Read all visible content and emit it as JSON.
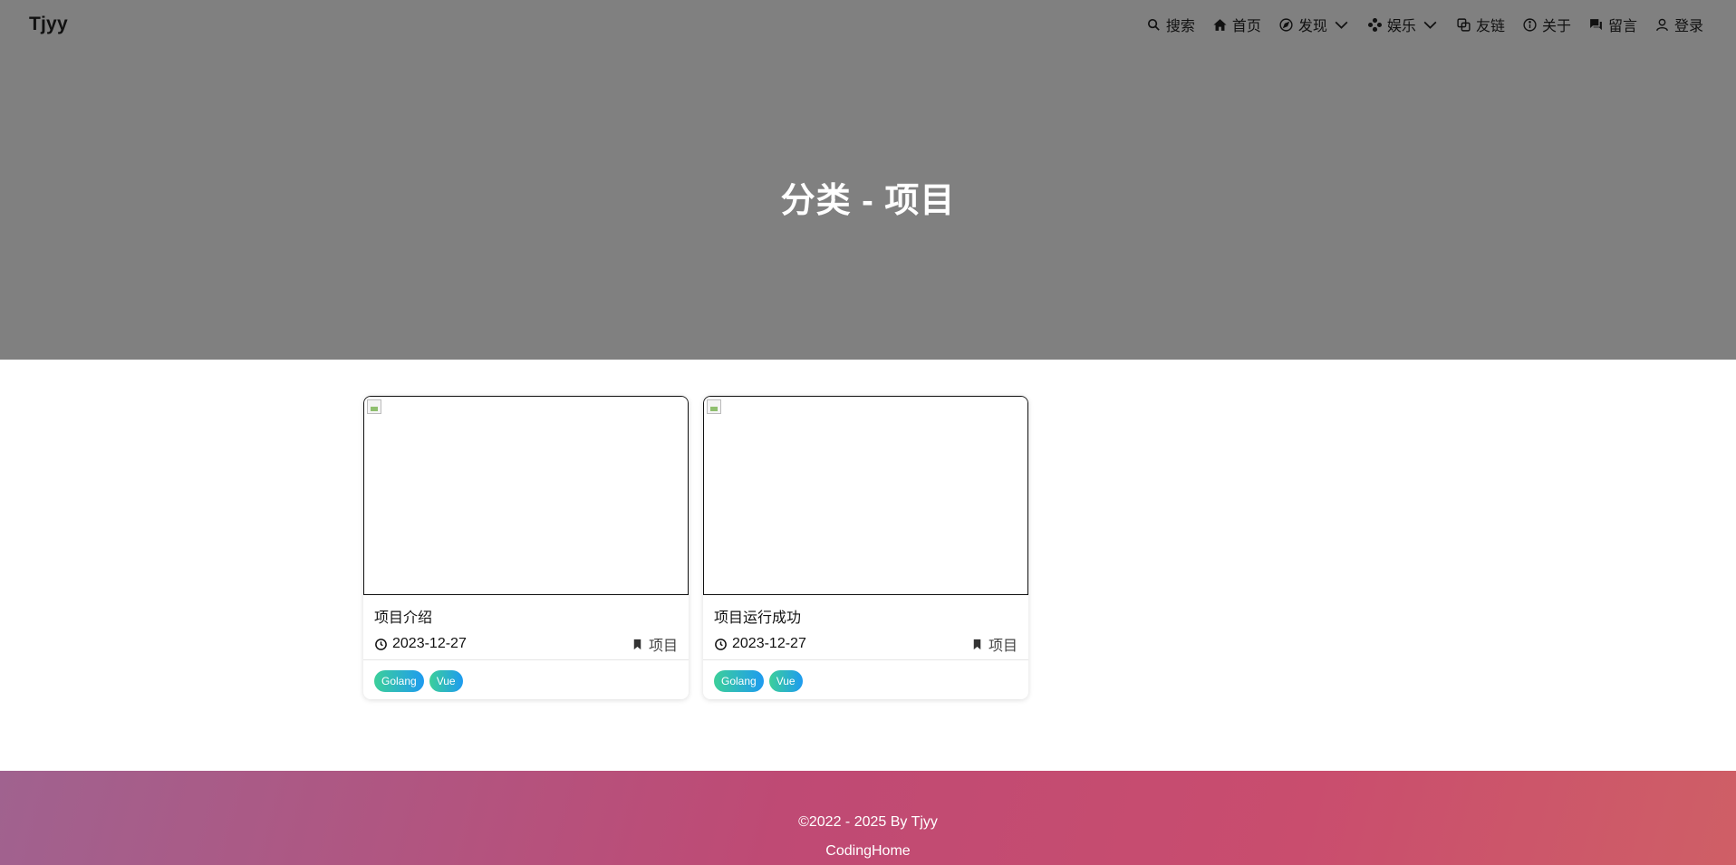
{
  "header": {
    "brand": "Tjyy",
    "nav": [
      {
        "label": "搜索",
        "icon": "search-icon"
      },
      {
        "label": "首页",
        "icon": "home-icon"
      },
      {
        "label": "发现",
        "icon": "compass-icon",
        "dropdown": true
      },
      {
        "label": "娱乐",
        "icon": "gamepad-icon",
        "dropdown": true
      },
      {
        "label": "友链",
        "icon": "link-icon"
      },
      {
        "label": "关于",
        "icon": "info-icon"
      },
      {
        "label": "留言",
        "icon": "chat-icon"
      },
      {
        "label": "登录",
        "icon": "user-icon"
      }
    ]
  },
  "hero": {
    "title": "分类 - 项目",
    "background_color": "#808080"
  },
  "posts": [
    {
      "title": "项目介绍",
      "date": "2023-12-27",
      "category": "项目",
      "tags": [
        "Golang",
        "Vue"
      ]
    },
    {
      "title": "项目运行成功",
      "date": "2023-12-27",
      "category": "项目",
      "tags": [
        "Golang",
        "Vue"
      ]
    }
  ],
  "footer": {
    "copyright": "©2022 - 2025 By Tjyy",
    "site": "CodingHome"
  },
  "colors": {
    "tag_gradient_start": "#3ccf9a",
    "tag_gradient_end": "#1e9bf0",
    "footer_gradient_start": "#a0628f",
    "footer_gradient_end": "#cf5f66"
  }
}
